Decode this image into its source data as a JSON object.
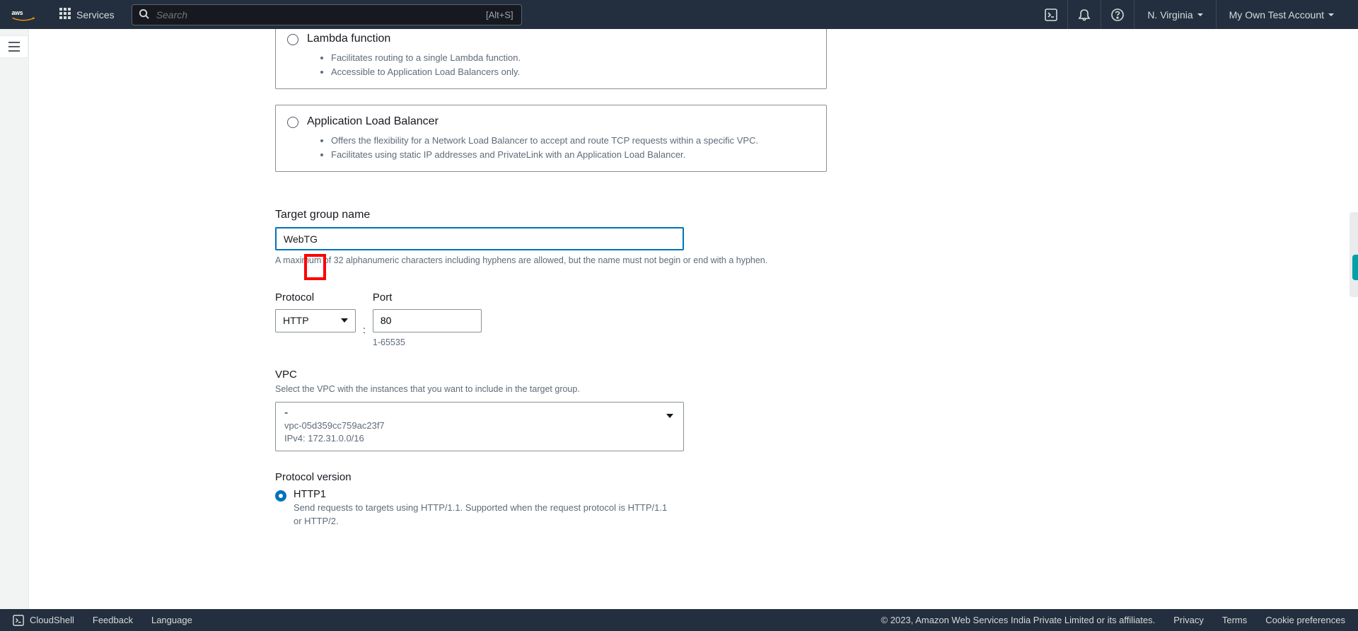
{
  "nav": {
    "services": "Services",
    "search_placeholder": "Search",
    "search_kbd": "[Alt+S]",
    "region": "N. Virginia",
    "account": "My Own Test Account"
  },
  "targetTypes": {
    "lambda": {
      "title": "Lambda function",
      "b1": "Facilitates routing to a single Lambda function.",
      "b2": "Accessible to Application Load Balancers only."
    },
    "alb": {
      "title": "Application Load Balancer",
      "b1": "Offers the flexibility for a Network Load Balancer to accept and route TCP requests within a specific VPC.",
      "b2": "Facilitates using static IP addresses and PrivateLink with an Application Load Balancer."
    }
  },
  "tgName": {
    "label": "Target group name",
    "value": "WebTG",
    "helper": "A maximum of 32 alphanumeric characters including hyphens are allowed, but the name must not begin or end with a hyphen."
  },
  "protocol": {
    "label": "Protocol",
    "value": "HTTP"
  },
  "port": {
    "label": "Port",
    "value": "80",
    "helper": "1-65535"
  },
  "vpc": {
    "label": "VPC",
    "helper": "Select the VPC with the instances that you want to include in the target group.",
    "selected_dash": "-",
    "id": "vpc-05d359cc759ac23f7",
    "cidr": "IPv4: 172.31.0.0/16"
  },
  "protoVersion": {
    "label": "Protocol version",
    "http1": "HTTP1",
    "http1_desc": "Send requests to targets using HTTP/1.1. Supported when the request protocol is HTTP/1.1 or HTTP/2."
  },
  "footer": {
    "cloudshell": "CloudShell",
    "feedback": "Feedback",
    "language": "Language",
    "copyright": "© 2023, Amazon Web Services India Private Limited or its affiliates.",
    "privacy": "Privacy",
    "terms": "Terms",
    "cookies": "Cookie preferences"
  }
}
